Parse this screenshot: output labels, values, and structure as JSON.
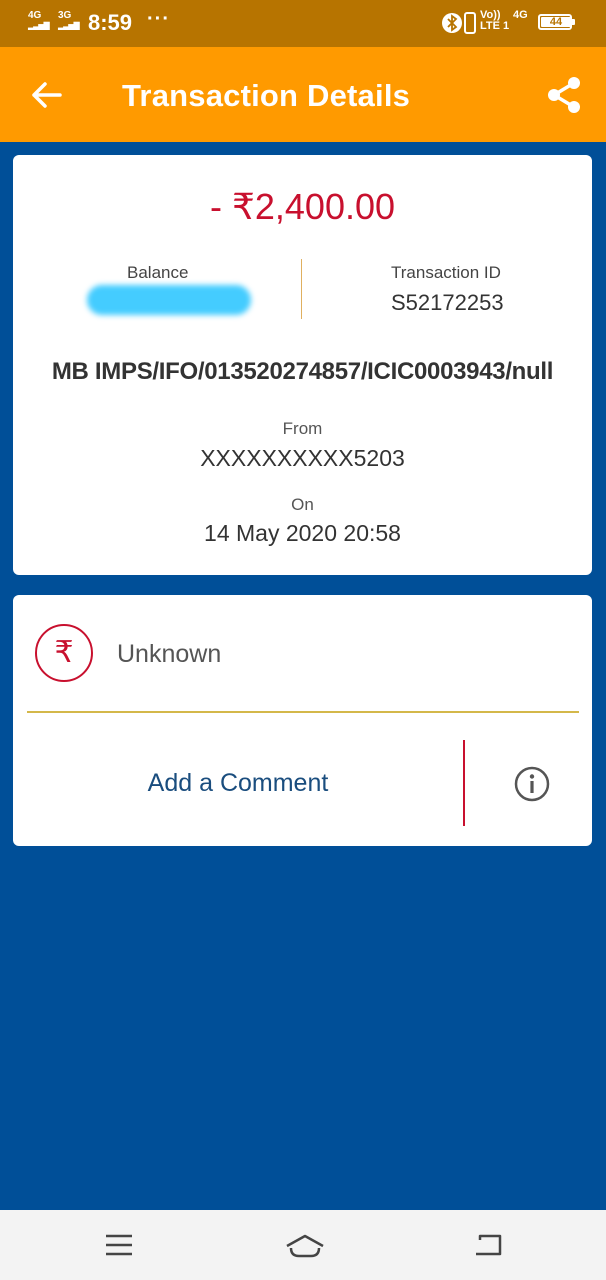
{
  "status_bar": {
    "network1": "4G",
    "network2": "3G",
    "time": "8:59",
    "more": "···",
    "volte": "Vo))",
    "lte": "LTE 1",
    "network3": "4G",
    "battery": "44"
  },
  "app_bar": {
    "title": "Transaction Details",
    "back_icon": "arrow-left-icon",
    "share_icon": "share-icon"
  },
  "transaction": {
    "amount": "- ₹2,400.00",
    "balance_label": "Balance",
    "transaction_id_label": "Transaction ID",
    "transaction_id": "S52172253",
    "narration": "MB IMPS/IFO/013520274857/ICIC0003943/null",
    "from_label": "From",
    "from_value": "XXXXXXXXXX5203",
    "on_label": "On",
    "on_value": "14 May 2020 20:58"
  },
  "category": {
    "icon_symbol": "₹",
    "label": "Unknown"
  },
  "comment": {
    "label": "Add a Comment",
    "info_icon": "info-icon"
  },
  "colors": {
    "status_bar": "#b77400",
    "app_bar": "#ff9a00",
    "background": "#004f98",
    "amount_red": "#c8102e",
    "comment_blue": "#1a4d7e"
  },
  "nav_bar": {
    "icons": [
      "menu-icon",
      "home-icon",
      "back-icon"
    ]
  }
}
